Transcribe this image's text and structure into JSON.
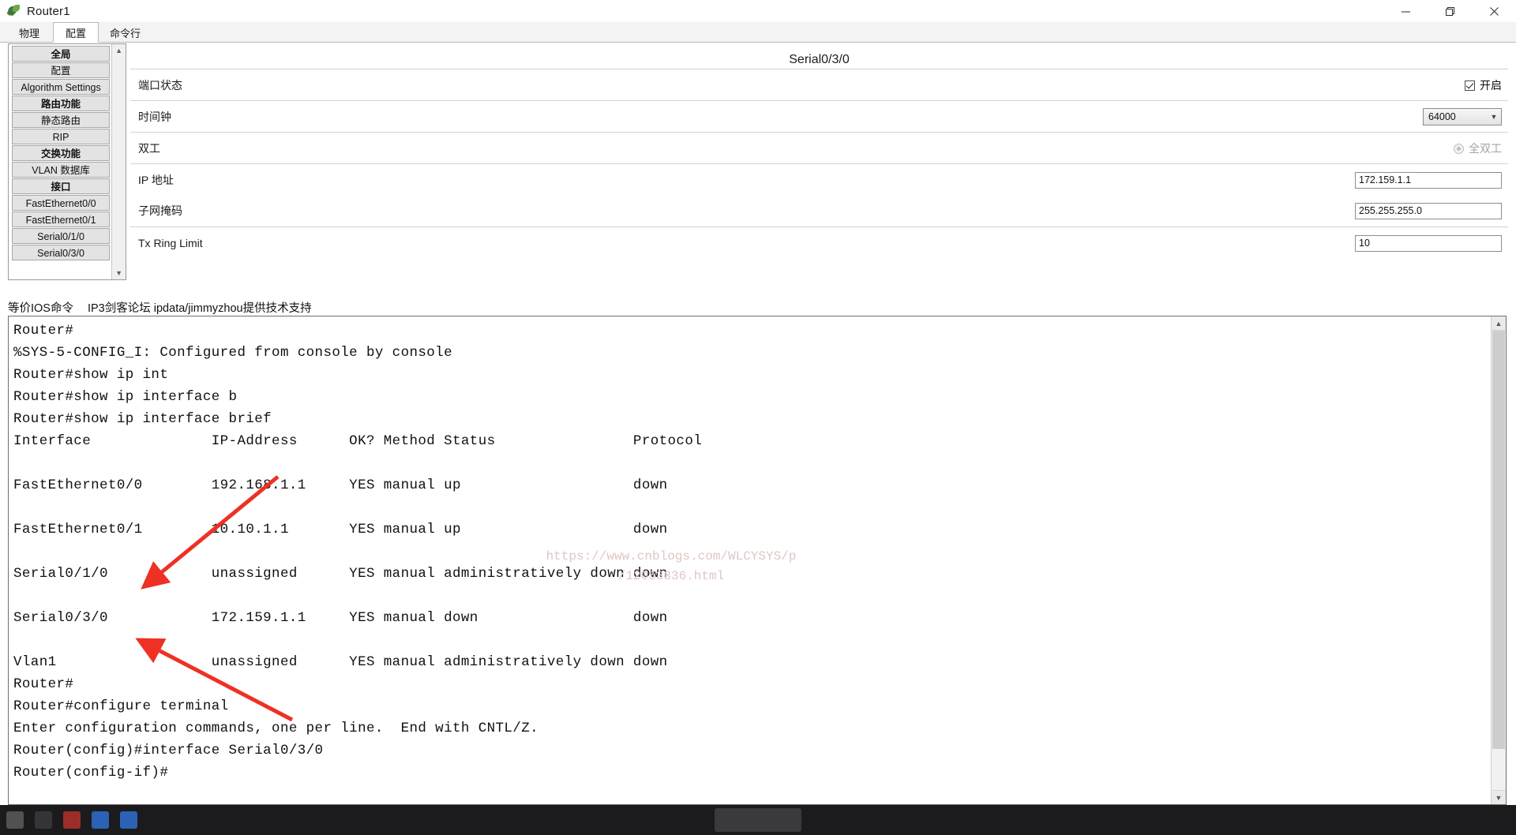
{
  "window": {
    "title": "Router1",
    "icon": "packet-tracer-leaf-icon",
    "controls": {
      "minimize": "minimize-icon",
      "maximize": "maximize-icon",
      "close": "close-icon"
    }
  },
  "tabs": [
    {
      "label": "物理",
      "active": false
    },
    {
      "label": "配置",
      "active": true
    },
    {
      "label": "命令行",
      "active": false
    }
  ],
  "sidebar": {
    "items": [
      {
        "label": "全局",
        "group": true
      },
      {
        "label": "配置",
        "group": false
      },
      {
        "label": "Algorithm Settings",
        "group": false
      },
      {
        "label": "路由功能",
        "group": true
      },
      {
        "label": "静态路由",
        "group": false
      },
      {
        "label": "RIP",
        "group": false
      },
      {
        "label": "交换功能",
        "group": true
      },
      {
        "label": "VLAN 数据库",
        "group": false
      },
      {
        "label": "接口",
        "group": true
      },
      {
        "label": "FastEthernet0/0",
        "group": false
      },
      {
        "label": "FastEthernet0/1",
        "group": false
      },
      {
        "label": "Serial0/1/0",
        "group": false
      },
      {
        "label": "Serial0/3/0",
        "group": false
      }
    ],
    "scroll_up": "▲",
    "scroll_down": "▼"
  },
  "form": {
    "title": "Serial0/3/0",
    "port_status": {
      "label": "端口状态",
      "checkbox_label": "开启",
      "checked": true
    },
    "clock_rate": {
      "label": "时间钟",
      "value": "64000",
      "arrow": "▼"
    },
    "duplex": {
      "label": "双工",
      "option_label": "全双工",
      "selected": true,
      "disabled": true
    },
    "ip_address": {
      "label": "IP 地址",
      "value": "172.159.1.1"
    },
    "subnet_mask": {
      "label": "子网掩码",
      "value": "255.255.255.0"
    },
    "tx_ring_limit": {
      "label": "Tx Ring Limit",
      "value": "10"
    }
  },
  "ios_bar": {
    "equivalent_label": "等价IOS命令",
    "credit": "IP3剑客论坛 ipdata/jimmyzhou提供技术支持"
  },
  "terminal": {
    "scroll_up": "▲",
    "scroll_down": "▼",
    "text": "Router#\n%SYS-5-CONFIG_I: Configured from console by console\nRouter#show ip int\nRouter#show ip interface b\nRouter#show ip interface brief\nInterface              IP-Address      OK? Method Status                Protocol\n\nFastEthernet0/0        192.168.1.1     YES manual up                    down\n\nFastEthernet0/1        10.10.1.1       YES manual up                    down\n\nSerial0/1/0            unassigned      YES manual administratively down down\n\nSerial0/3/0            172.159.1.1     YES manual down                  down\n\nVlan1                  unassigned      YES manual administratively down down\nRouter#\nRouter#configure terminal\nEnter configuration commands, one per line.  End with CNTL/Z.\nRouter(config)#interface Serial0/3/0\nRouter(config-if)#"
  },
  "watermark": {
    "line1": "https://www.cnblogs.com/WLCYSYS/p",
    "line2": "/12053836.html"
  },
  "annotations": {
    "arrow_color": "#ee3124",
    "arrow1_target": "Serial0/1/0",
    "arrow2_target": "Serial0/3/0"
  }
}
